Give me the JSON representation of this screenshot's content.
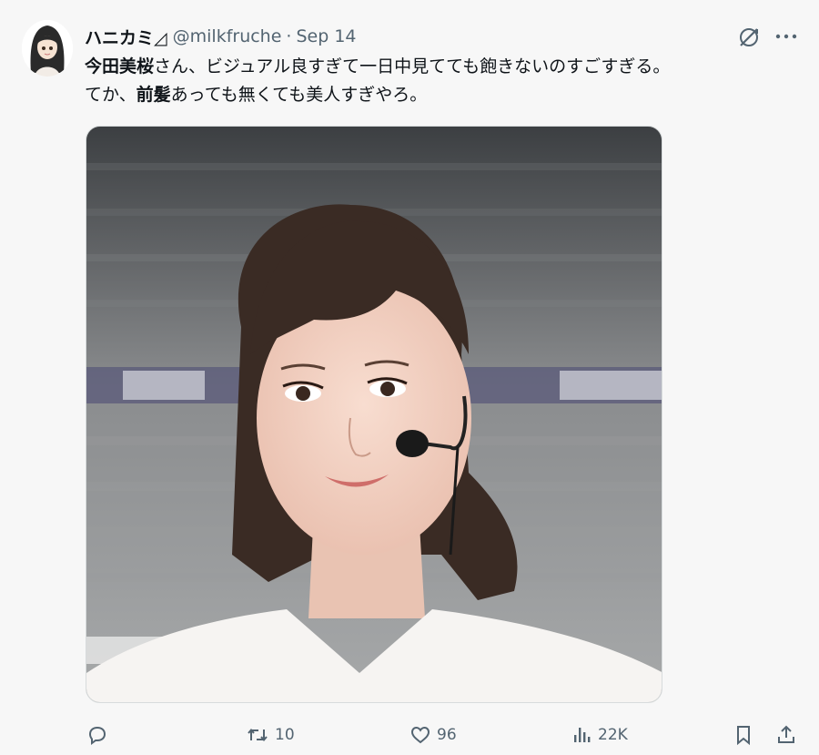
{
  "author": {
    "display_name": "ハニカミ◿",
    "handle": "@milkfruche",
    "separator": "·",
    "date": "Sep 14"
  },
  "tweet": {
    "line1_bold": "今田美桜",
    "line1_rest": "さん、ビジュアル良すぎて一日中見てても飽きないのすごすぎる。",
    "line2_pre": "てか、",
    "line2_bold": "前髪",
    "line2_rest": "あっても無くても美人すぎやろ。"
  },
  "actions": {
    "retweets": "10",
    "likes": "96",
    "views": "22K"
  },
  "icons": {
    "header": [
      "grok-icon",
      "more-icon"
    ],
    "actions": [
      "reply-icon",
      "retweet-icon",
      "like-icon",
      "views-icon",
      "bookmark-icon",
      "share-icon"
    ]
  },
  "colors": {
    "text": "#0f1419",
    "secondary": "#536471",
    "background": "#f7f7f7"
  }
}
